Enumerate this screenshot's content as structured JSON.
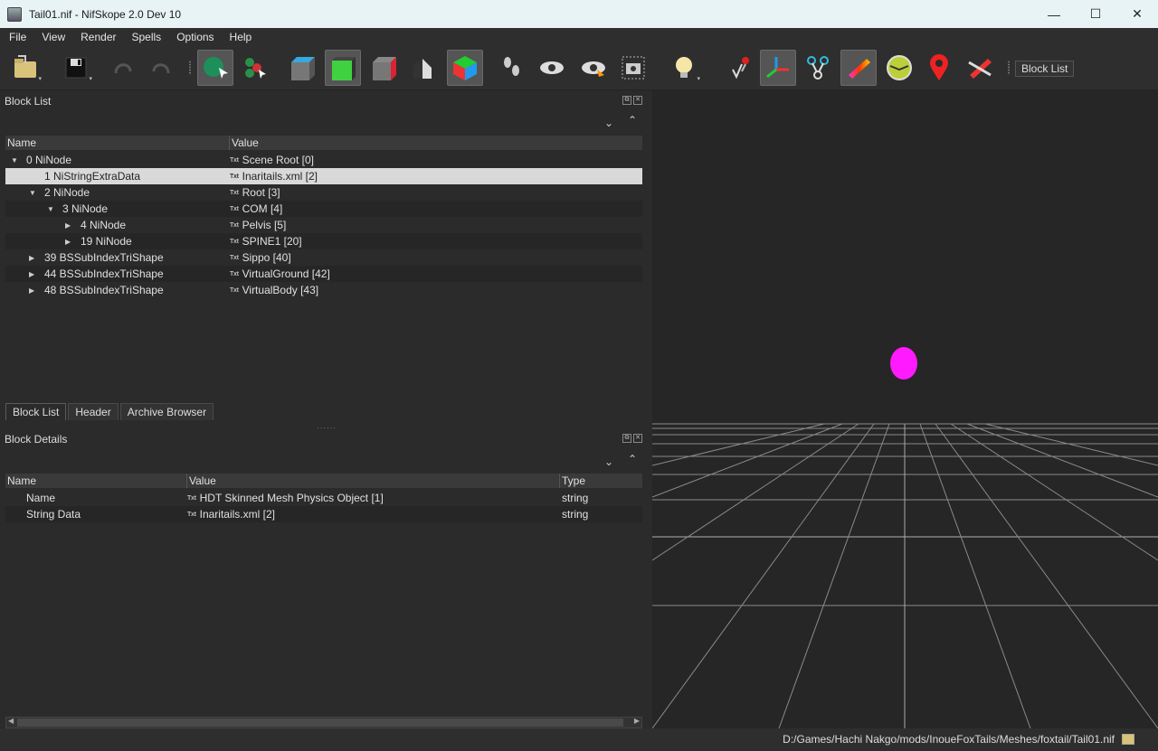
{
  "window": {
    "title": "Tail01.nif - NifSkope 2.0 Dev 10",
    "minimize": "—",
    "maximize": "☐",
    "close": "✕"
  },
  "menu": [
    "File",
    "View",
    "Render",
    "Spells",
    "Options",
    "Help"
  ],
  "toolbar": {
    "block_list_label": "Block List"
  },
  "block_list": {
    "title": "Block List",
    "columns": {
      "name": "Name",
      "value": "Value"
    },
    "rows": [
      {
        "name": "0 NiNode",
        "value": "Scene Root [0]"
      },
      {
        "name": "1 NiStringExtraData",
        "value": "Inaritails.xml [2]"
      },
      {
        "name": "2 NiNode",
        "value": "Root [3]"
      },
      {
        "name": "3 NiNode",
        "value": "COM [4]"
      },
      {
        "name": "4 NiNode",
        "value": "Pelvis [5]"
      },
      {
        "name": "19 NiNode",
        "value": "SPINE1 [20]"
      },
      {
        "name": "39 BSSubIndexTriShape",
        "value": "Sippo [40]"
      },
      {
        "name": "44 BSSubIndexTriShape",
        "value": "VirtualGround [42]"
      },
      {
        "name": "48 BSSubIndexTriShape",
        "value": "VirtualBody [43]"
      }
    ]
  },
  "tabs": [
    "Block List",
    "Header",
    "Archive Browser"
  ],
  "block_details": {
    "title": "Block Details",
    "columns": {
      "name": "Name",
      "value": "Value",
      "type": "Type"
    },
    "rows": [
      {
        "name": "Name",
        "value": "HDT Skinned Mesh Physics Object [1]",
        "type": "string"
      },
      {
        "name": "String Data",
        "value": "Inaritails.xml [2]",
        "type": "string"
      }
    ]
  },
  "status": {
    "path": "D:/Games/Hachi Nakgo/mods/InoueFoxTails/Meshes/foxtail/Tail01.nif"
  },
  "colors": {
    "selection": "#d9d9d9",
    "viewport_bg": "#262626",
    "marker": "#ff1aff"
  }
}
